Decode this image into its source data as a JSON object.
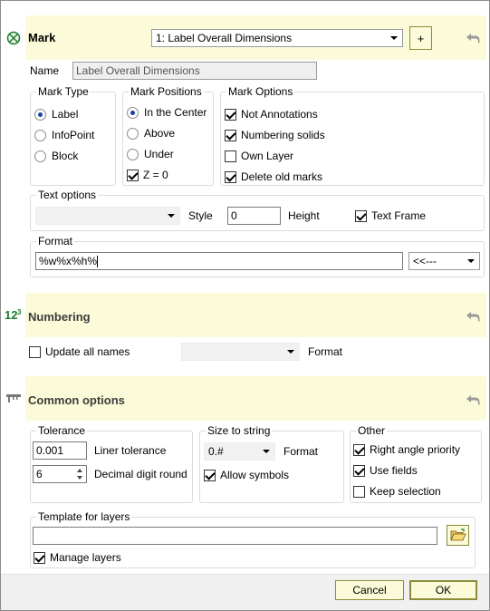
{
  "colors": {
    "band": "#fbfbd9",
    "accent": "#1b3fa6",
    "button_border": "#8d8a3a"
  },
  "mark": {
    "title": "Mark",
    "icon": "mark-crossed-circle-icon",
    "preset_value": "1: Label Overall Dimensions",
    "add_label": "+",
    "name_label": "Name",
    "name_value": "Label Overall Dimensions",
    "mark_type": {
      "title": "Mark Type",
      "options": [
        "Label",
        "InfoPoint",
        "Block"
      ],
      "selected": "Label"
    },
    "mark_positions": {
      "title": "Mark Positions",
      "options": [
        "In the Center",
        "Above",
        "Under"
      ],
      "selected": "In the Center",
      "z_label": "Z = 0",
      "z_checked": true
    },
    "mark_options": {
      "title": "Mark Options",
      "items": [
        {
          "label": "Not Annotations",
          "checked": true
        },
        {
          "label": "Numbering solids",
          "checked": true
        },
        {
          "label": "Own Layer",
          "checked": false
        },
        {
          "label": "Delete old marks",
          "checked": true
        }
      ]
    },
    "text_options": {
      "title": "Text options",
      "style_label": "Style",
      "style_value": "",
      "height_value": "0",
      "height_label": "Height",
      "text_frame_label": "Text Frame",
      "text_frame_checked": true
    },
    "format": {
      "title": "Format",
      "value": "%w%x%h%",
      "insert_label": "<<---"
    }
  },
  "numbering": {
    "title": "Numbering",
    "icon": "numbering-123-icon",
    "update_all_label": "Update all names",
    "update_all_checked": false,
    "format_value": "",
    "format_label": "Format"
  },
  "common": {
    "title": "Common options",
    "icon": "common-options-icon",
    "tolerance": {
      "title": "Tolerance",
      "liner_value": "0.001",
      "liner_label": "Liner tolerance",
      "decimal_value": "6",
      "decimal_label": "Decimal digit round"
    },
    "size_to_string": {
      "title": "Size to string",
      "format_value": "0.#",
      "format_label": "Format",
      "allow_symbols_label": "Allow symbols",
      "allow_symbols_checked": true
    },
    "other": {
      "title": "Other",
      "items": [
        {
          "label": "Right angle priority",
          "checked": true
        },
        {
          "label": "Use fields",
          "checked": true
        },
        {
          "label": "Keep selection",
          "checked": false
        }
      ]
    },
    "template": {
      "title": "Template for layers",
      "value": "",
      "manage_layers_label": "Manage layers",
      "manage_layers_checked": true
    }
  },
  "footer": {
    "cancel_label": "Cancel",
    "ok_label": "OK"
  }
}
